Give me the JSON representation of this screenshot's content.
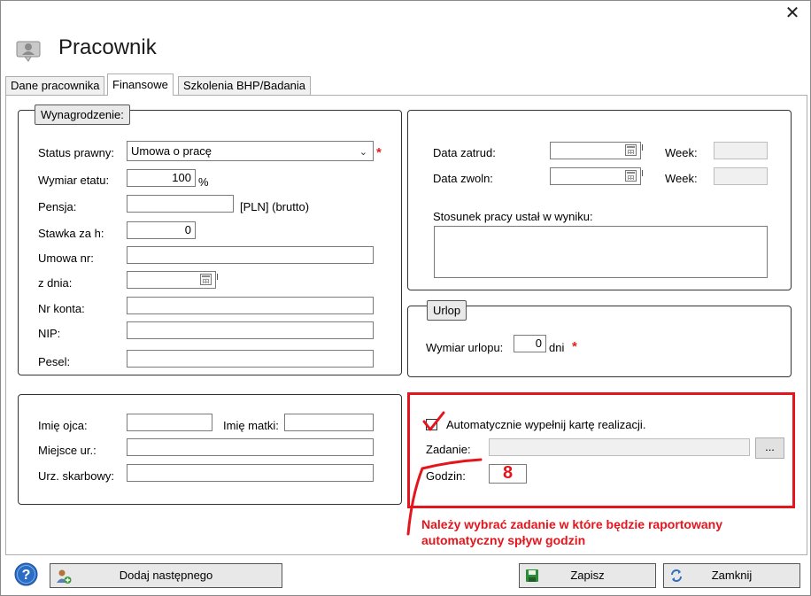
{
  "window": {
    "title": "Pracownik",
    "close_glyph": "✕"
  },
  "tabs": [
    {
      "label": "Dane pracownika",
      "active": false
    },
    {
      "label": "Finansowe",
      "active": true
    },
    {
      "label": "Szkolenia BHP/Badania",
      "active": false
    }
  ],
  "wynagrodzenie": {
    "legend": "Wynagrodzenie:",
    "status_label": "Status prawny:",
    "status_value": "Umowa o pracę",
    "wymiar_label": "Wymiar etatu:",
    "wymiar_value": "100",
    "wymiar_unit": "%",
    "pensja_label": "Pensja:",
    "pensja_value": "",
    "pensja_unit": "[PLN] (brutto)",
    "stawka_label": "Stawka za h:",
    "stawka_value": "0",
    "umowa_label": "Umowa nr:",
    "umowa_value": "",
    "zdnia_label": "z dnia:",
    "zdnia_value": "",
    "konto_label": "Nr konta:",
    "konto_value": "",
    "nip_label": "NIP:",
    "nip_value": "",
    "pesel_label": "Pesel:",
    "pesel_value": ""
  },
  "zatrudnienie": {
    "data_zatrud_label": "Data zatrud:",
    "data_zatrud_value": "",
    "data_zwoln_label": "Data zwoln:",
    "data_zwoln_value": "",
    "week_label_1": "Week:",
    "week_value_1": "",
    "week_label_2": "Week:",
    "week_value_2": "",
    "stosunek_label": "Stosunek pracy ustał w wyniku:",
    "stosunek_value": ""
  },
  "urlop": {
    "legend": "Urlop",
    "wymiar_label": "Wymiar urlopu:",
    "wymiar_value": "0",
    "unit": "dni"
  },
  "osobowe": {
    "ojca_label": "Imię ojca:",
    "ojca_value": "",
    "matki_label": "Imię matki:",
    "matki_value": "",
    "miejsce_label": "Miejsce ur.:",
    "miejsce_value": "",
    "urzad_label": "Urz. skarbowy:",
    "urzad_value": ""
  },
  "realizacja": {
    "checkbox_label": "Automatycznie wypełnij kartę realizacji.",
    "checked": true,
    "zadanie_label": "Zadanie:",
    "zadanie_value": "",
    "browse_label": "...",
    "godzin_label": "Godzin:",
    "godzin_value": "8"
  },
  "annotation": {
    "line1": "Należy wybrać zadanie w które będzie raportowany",
    "line2": "automatyczny spływ godzin"
  },
  "footer": {
    "help_glyph": "?",
    "add_next_label": "Dodaj następnego",
    "save_label": "Zapisz",
    "close_label": "Zamknij"
  },
  "colors": {
    "accent_red": "#e4151c",
    "help_blue": "#2b6cc4",
    "save_green": "#2e8b3a"
  }
}
